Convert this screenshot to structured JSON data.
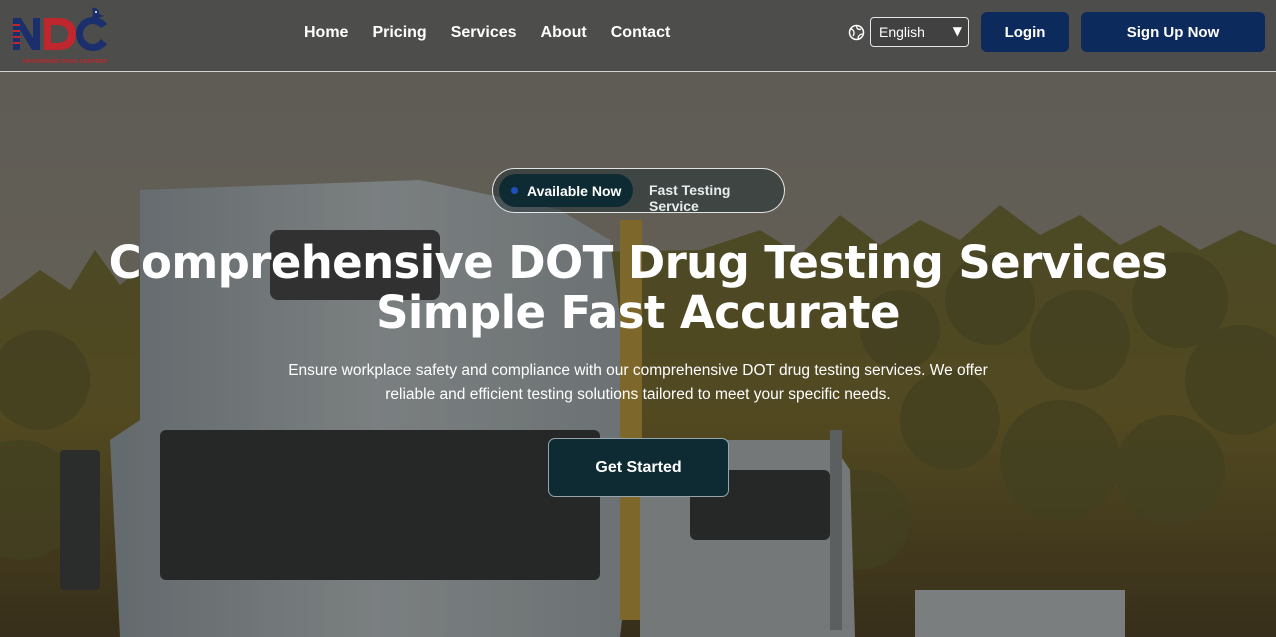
{
  "brand": {
    "logo_text": "NDC",
    "logo_caption": "NATIONWIDE DRUG CENTERS",
    "colors": {
      "navy": "#1a2f6b",
      "red": "#c0262d"
    }
  },
  "nav": {
    "items": [
      {
        "label": "Home"
      },
      {
        "label": "Pricing"
      },
      {
        "label": "Services"
      },
      {
        "label": "About"
      },
      {
        "label": "Contact"
      }
    ]
  },
  "language": {
    "icon": "globe-icon",
    "selected": "English",
    "caret": "▼"
  },
  "auth": {
    "login_label": "Login",
    "signup_label": "Sign Up Now",
    "button_color": "#0c2a5c"
  },
  "hero": {
    "badge": {
      "status_label": "Available Now",
      "service_label": "Fast Testing Service"
    },
    "headline_line1": "Comprehensive DOT Drug Testing Services",
    "headline_line2": "Simple Fast Accurate",
    "description": "Ensure workplace safety and compliance with our comprehensive DOT drug testing services. We offer reliable and efficient testing solutions tailored to meet your specific needs.",
    "cta_label": "Get Started",
    "cta_color": "#0e2b33"
  }
}
